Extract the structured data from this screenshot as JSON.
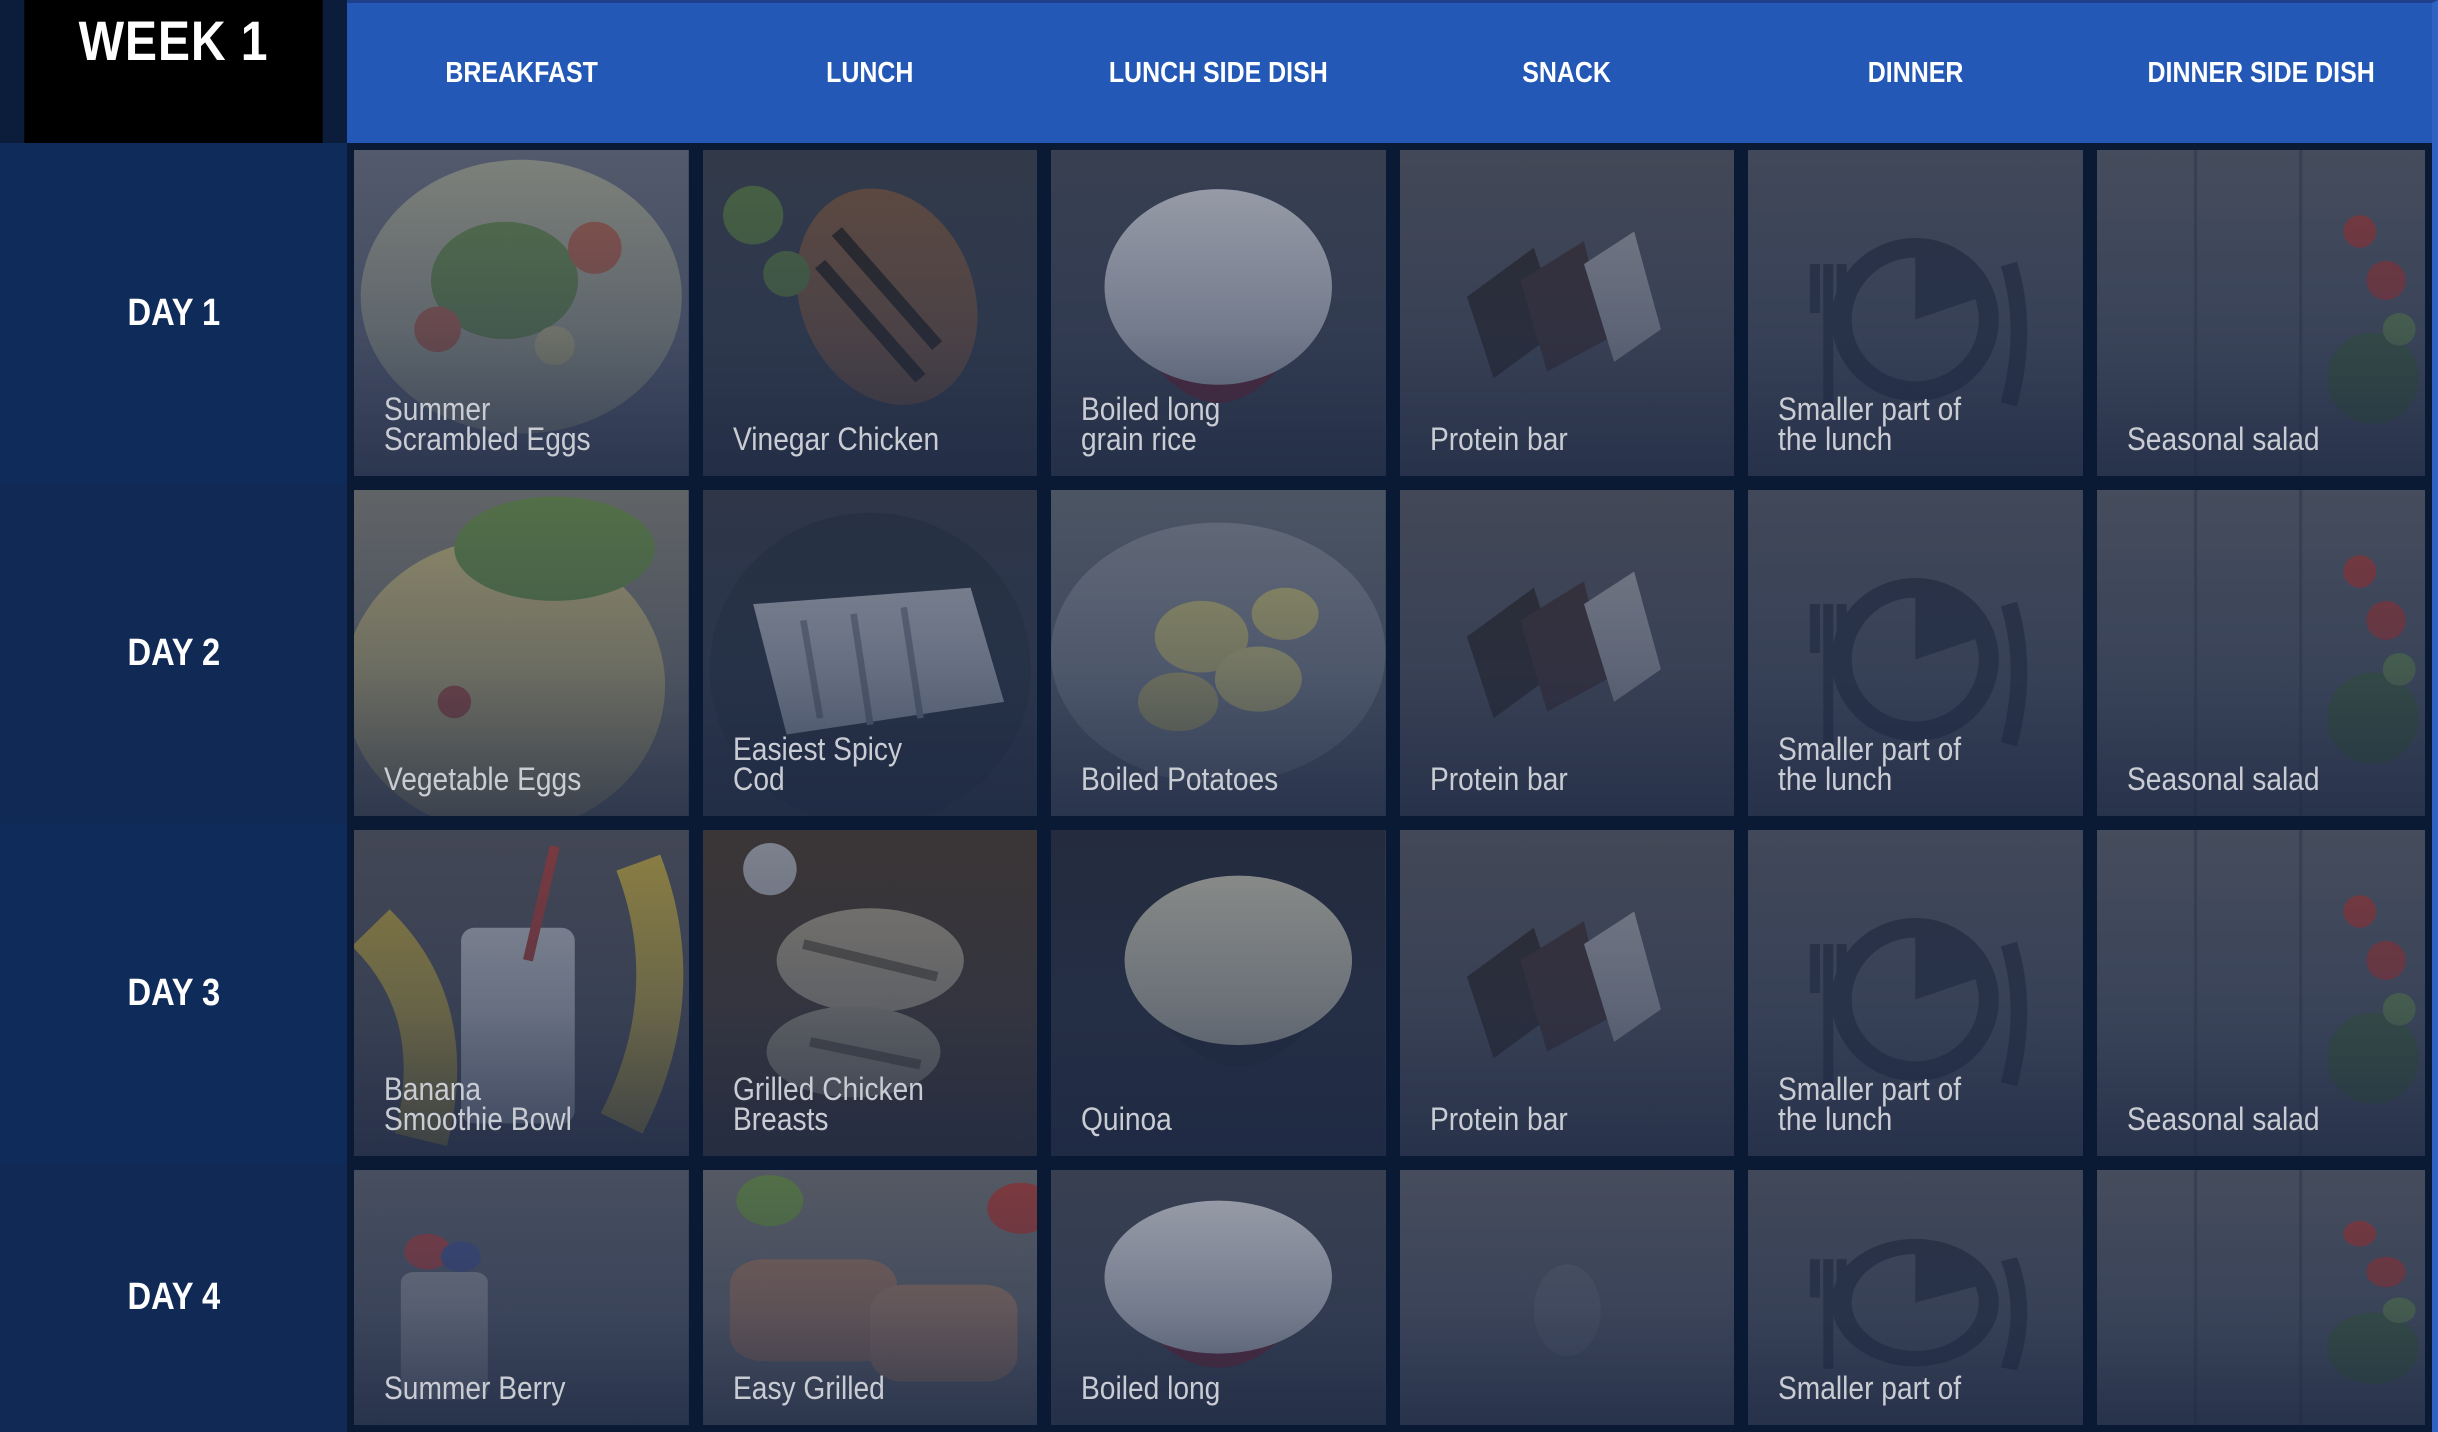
{
  "week_label": "WEEK 1",
  "columns": [
    "BREAKFAST",
    "LUNCH",
    "LUNCH SIDE DISH",
    "SNACK",
    "DINNER",
    "DINNER SIDE DISH"
  ],
  "days": [
    {
      "label": "DAY 1",
      "meals": [
        {
          "name": "Summer\nScrambled Eggs",
          "image": "scrambled-eggs-photo"
        },
        {
          "name": "Vinegar Chicken",
          "image": "grilled-chicken-photo"
        },
        {
          "name": "Boiled long\ngrain rice",
          "image": "rice-bowl-photo"
        },
        {
          "name": "Protein bar",
          "image": "protein-bar-photo"
        },
        {
          "name": "Smaller part of\nthe lunch",
          "image": "plate-cutlery-icon"
        },
        {
          "name": "Seasonal salad",
          "image": "salad-photo"
        }
      ]
    },
    {
      "label": "DAY 2",
      "meals": [
        {
          "name": "Vegetable Eggs",
          "image": "vegetable-omelette-photo"
        },
        {
          "name": "Easiest Spicy\nCod",
          "image": "cod-fillet-photo"
        },
        {
          "name": "Boiled Potatoes",
          "image": "boiled-potatoes-photo"
        },
        {
          "name": "Protein bar",
          "image": "protein-bar-photo"
        },
        {
          "name": "Smaller part of\nthe lunch",
          "image": "plate-cutlery-icon"
        },
        {
          "name": "Seasonal salad",
          "image": "salad-photo"
        }
      ]
    },
    {
      "label": "DAY 3",
      "meals": [
        {
          "name": "Banana\nSmoothie Bowl",
          "image": "banana-smoothie-photo"
        },
        {
          "name": "Grilled Chicken\nBreasts",
          "image": "grilled-chicken-breasts-photo"
        },
        {
          "name": "Quinoa",
          "image": "quinoa-bowl-photo"
        },
        {
          "name": "Protein bar",
          "image": "protein-bar-photo"
        },
        {
          "name": "Smaller part of\nthe lunch",
          "image": "plate-cutlery-icon"
        },
        {
          "name": "Seasonal salad",
          "image": "salad-photo"
        }
      ]
    },
    {
      "label": "DAY 4",
      "meals": [
        {
          "name": "Summer Berry",
          "image": "berry-parfait-photo"
        },
        {
          "name": "Easy Grilled",
          "image": "grilled-meat-photo"
        },
        {
          "name": "Boiled long",
          "image": "rice-bowl-photo"
        },
        {
          "name": "",
          "image": "blank-snack-photo"
        },
        {
          "name": "Smaller part of",
          "image": "plate-cutlery-icon"
        },
        {
          "name": "",
          "image": "salad-photo"
        }
      ]
    }
  ]
}
